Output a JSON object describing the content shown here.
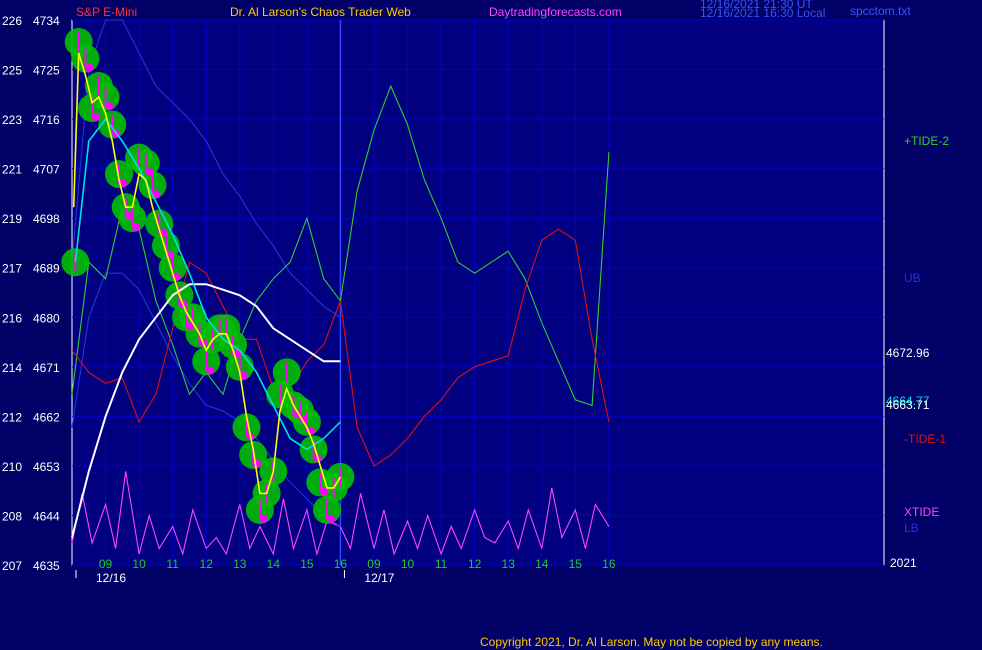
{
  "header": {
    "instrument": "S&P E-Mini",
    "title": "Dr. Al Larson's Chaos Trader Web",
    "site": "Daytradingforecasts.com",
    "stamp_line1": "12/16/2021 21:30 UT",
    "stamp_line2": "12/16/2021 16:30 Local",
    "file": "spcctom.txt"
  },
  "footer": {
    "copyright": "Copyright 2021, Dr. Al Larson. May not be copied by any means.",
    "year": "2021"
  },
  "colors": {
    "background": "#000066",
    "plot_bg": "#000080",
    "grid": "#0000cc",
    "price_bars": "#ff00ff",
    "halo": "#00c000",
    "fast_ma": "#ffff00",
    "mid_ma": "#00e0e0",
    "slow_ma": "#ffffff",
    "tide_plus": "#33cc33",
    "tide_minus": "#e01010",
    "xtide": "#ff44ff",
    "bands": "#2233dd",
    "axis_text": "#ffffff",
    "hour_labels": "#22cc22",
    "title_text": "#ffcc00",
    "site_text": "#ff44ff"
  },
  "chart_data": {
    "type": "line",
    "y_axis_pairs": [
      {
        "cycle": "226",
        "price": "4734"
      },
      {
        "cycle": "225",
        "price": "4725"
      },
      {
        "cycle": "223",
        "price": "4716"
      },
      {
        "cycle": "221",
        "price": "4707"
      },
      {
        "cycle": "219",
        "price": "4698"
      },
      {
        "cycle": "217",
        "price": "4689"
      },
      {
        "cycle": "216",
        "price": "4680"
      },
      {
        "cycle": "214",
        "price": "4671"
      },
      {
        "cycle": "212",
        "price": "4662"
      },
      {
        "cycle": "210",
        "price": "4653"
      },
      {
        "cycle": "208",
        "price": "4644"
      },
      {
        "cycle": "207",
        "price": "4635"
      }
    ],
    "ylim": [
      4635,
      4734
    ],
    "xlim": [
      8,
      32.2
    ],
    "hour_ticks": [
      {
        "x": 9,
        "label": "09"
      },
      {
        "x": 10,
        "label": "10"
      },
      {
        "x": 11,
        "label": "11"
      },
      {
        "x": 12,
        "label": "12"
      },
      {
        "x": 13,
        "label": "13"
      },
      {
        "x": 14,
        "label": "14"
      },
      {
        "x": 15,
        "label": "15"
      },
      {
        "x": 16,
        "label": "16"
      },
      {
        "x": 17,
        "label": "09"
      },
      {
        "x": 18,
        "label": "10"
      },
      {
        "x": 19,
        "label": "11"
      },
      {
        "x": 20,
        "label": "12"
      },
      {
        "x": 21,
        "label": "13"
      },
      {
        "x": 22,
        "label": "14"
      },
      {
        "x": 23,
        "label": "15"
      },
      {
        "x": 24,
        "label": "16"
      }
    ],
    "dates": [
      {
        "x": 8,
        "label": "12/16"
      },
      {
        "x": 16,
        "label": "12/17"
      }
    ],
    "day_divider_x": 16,
    "grid": true,
    "price_bars": {
      "name": "",
      "x": [
        8.1,
        8.2,
        8.4,
        8.6,
        8.8,
        9.0,
        9.2,
        9.4,
        9.6,
        9.8,
        10.0,
        10.2,
        10.4,
        10.6,
        10.8,
        11.0,
        11.2,
        11.4,
        11.6,
        11.8,
        12.0,
        12.2,
        12.4,
        12.6,
        12.8,
        13.0,
        13.2,
        13.4,
        13.6,
        13.8,
        14.0,
        14.2,
        14.4,
        14.6,
        14.8,
        15.0,
        15.2,
        15.4,
        15.6,
        15.8,
        16.0
      ],
      "y": [
        4690,
        4730,
        4727,
        4718,
        4722,
        4720,
        4715,
        4706,
        4700,
        4698,
        4709,
        4708,
        4704,
        4697,
        4693,
        4689,
        4684,
        4680,
        4680,
        4677,
        4672,
        4676,
        4678,
        4678,
        4675,
        4671,
        4660,
        4655,
        4645,
        4648,
        4652,
        4666,
        4670,
        4664,
        4663,
        4661,
        4656,
        4650,
        4645,
        4649,
        4651
      ]
    },
    "series": [
      {
        "name": "",
        "role": "fast-ma",
        "x": [
          8.05,
          8.2,
          8.4,
          8.6,
          8.8,
          9.0,
          9.2,
          9.4,
          9.6,
          9.8,
          10.0,
          10.2,
          10.4,
          10.6,
          10.8,
          11.0,
          11.2,
          11.4,
          11.6,
          11.8,
          12.0,
          12.2,
          12.4,
          12.6,
          12.8,
          13.0,
          13.2,
          13.4,
          13.6,
          13.8,
          14.0,
          14.2,
          14.4,
          14.6,
          14.8,
          15.0,
          15.2,
          15.4,
          15.6,
          15.8,
          16.0
        ],
        "y": [
          4700,
          4728,
          4724,
          4719,
          4720,
          4717,
          4712,
          4705,
          4700,
          4700,
          4706,
          4705,
          4700,
          4696,
          4692,
          4688,
          4684,
          4681,
          4679,
          4677,
          4674,
          4676,
          4677,
          4677,
          4674,
          4670,
          4662,
          4656,
          4648,
          4648,
          4652,
          4663,
          4667,
          4664,
          4662,
          4660,
          4657,
          4653,
          4649,
          4649,
          4651
        ]
      },
      {
        "name": "",
        "role": "mid-ma",
        "x": [
          8.1,
          8.5,
          9.0,
          9.5,
          10.0,
          10.5,
          11.0,
          11.5,
          12.0,
          12.5,
          13.0,
          13.5,
          14.0,
          14.5,
          15.0,
          15.5,
          16.0
        ],
        "y": [
          4690,
          4712,
          4716,
          4712,
          4707,
          4701,
          4695,
          4688,
          4680,
          4676,
          4674,
          4670,
          4664,
          4658,
          4656,
          4658,
          4661
        ]
      },
      {
        "name": "",
        "role": "slow-ma",
        "x": [
          8.0,
          8.5,
          9.0,
          9.5,
          10.0,
          10.5,
          11.0,
          11.5,
          12.0,
          12.5,
          13.0,
          13.5,
          14.0,
          14.5,
          15.0,
          15.5,
          16.0
        ],
        "y": [
          4640,
          4652,
          4662,
          4670,
          4676,
          4680,
          4684,
          4686,
          4686,
          4685,
          4684,
          4682,
          4678,
          4676,
          4674,
          4672,
          4672
        ]
      },
      {
        "name": "+TIDE-2",
        "role": "tide-plus",
        "x": [
          8.0,
          8.5,
          9.0,
          9.5,
          10.0,
          10.5,
          11.0,
          11.5,
          12.0,
          12.5,
          13.0,
          13.5,
          14.0,
          14.5,
          15.0,
          15.5,
          16.0,
          16.5,
          17.0,
          17.5,
          18.0,
          18.5,
          19.0,
          19.5,
          20.0,
          20.5,
          21.0,
          21.5,
          22.0,
          22.5,
          23.0,
          23.5,
          24.0
        ],
        "y": [
          4666,
          4690,
          4687,
          4700,
          4696,
          4683,
          4675,
          4666,
          4670,
          4666,
          4676,
          4683,
          4687,
          4690,
          4698,
          4687,
          4683,
          4703,
          4714,
          4722,
          4715,
          4705,
          4698,
          4690,
          4688,
          4690,
          4692,
          4687,
          4679,
          4672,
          4665,
          4664,
          4710
        ]
      },
      {
        "name": "-TIDE-1",
        "role": "tide-minus",
        "x": [
          8.0,
          8.5,
          9.0,
          9.5,
          10.0,
          10.5,
          11.0,
          11.5,
          12.0,
          12.5,
          13.0,
          13.5,
          14.0,
          14.5,
          15.0,
          15.5,
          16.0,
          16.5,
          17.0,
          17.5,
          18.0,
          18.5,
          19.0,
          19.5,
          20.0,
          20.5,
          21.0,
          21.5,
          22.0,
          22.5,
          23.0,
          23.5,
          24.0
        ],
        "y": [
          4674,
          4670,
          4668,
          4669,
          4661,
          4666,
          4678,
          4690,
          4688,
          4682,
          4676,
          4676,
          4667,
          4667,
          4672,
          4675,
          4683,
          4660,
          4653,
          4655,
          4658,
          4662,
          4665,
          4669,
          4671,
          4672,
          4673,
          4685,
          4694,
          4696,
          4694,
          4676,
          4661
        ]
      },
      {
        "name": "XTIDE",
        "role": "xtide",
        "x": [
          8.0,
          8.3,
          8.6,
          9.0,
          9.3,
          9.6,
          10.0,
          10.3,
          10.6,
          11.0,
          11.3,
          11.6,
          12.0,
          12.3,
          12.6,
          13.0,
          13.3,
          13.6,
          14.0,
          14.3,
          14.6,
          15.0,
          15.3,
          15.6,
          16.0,
          16.3,
          16.6,
          17.0,
          17.3,
          17.6,
          18.0,
          18.3,
          18.6,
          19.0,
          19.3,
          19.6,
          20.0,
          20.3,
          20.6,
          21.0,
          21.3,
          21.6,
          22.0,
          22.3,
          22.6,
          23.0,
          23.3,
          23.6,
          24.0
        ],
        "y": [
          4639,
          4648,
          4639,
          4646,
          4638,
          4652,
          4637,
          4644,
          4638,
          4642,
          4637,
          4645,
          4638,
          4640,
          4637,
          4646,
          4638,
          4642,
          4637,
          4647,
          4638,
          4645,
          4637,
          4643,
          4642,
          4638,
          4648,
          4638,
          4645,
          4637,
          4643,
          4638,
          4644,
          4637,
          4642,
          4638,
          4645,
          4640,
          4639,
          4643,
          4638,
          4645,
          4638,
          4649,
          4640,
          4645,
          4638,
          4646,
          4642
        ]
      },
      {
        "name": "UB",
        "role": "upper-band",
        "x": [
          8.0,
          8.5,
          9.0,
          9.5,
          10.0,
          10.5,
          11.0,
          11.5,
          12.0,
          12.5,
          13.0,
          13.5,
          14.0,
          14.5,
          15.0,
          15.5,
          16.0
        ],
        "y": [
          4690,
          4725,
          4734,
          4734,
          4728,
          4722,
          4719,
          4716,
          4712,
          4706,
          4702,
          4697,
          4693,
          4688,
          4685,
          4682,
          4680
        ]
      },
      {
        "name": "LB",
        "role": "lower-band",
        "x": [
          8.0,
          8.5,
          9.0,
          9.5,
          10.0,
          10.5,
          11.0,
          11.5,
          12.0,
          12.5,
          13.0,
          13.5,
          14.0,
          14.5,
          15.0,
          15.5,
          16.0
        ],
        "y": [
          4660,
          4680,
          4688,
          4688,
          4685,
          4679,
          4673,
          4668,
          4664,
          4663,
          4661,
          4658,
          4654,
          4650,
          4647,
          4644,
          4642
        ]
      }
    ],
    "right_labels": [
      {
        "name": "+TIDE-2",
        "series": "tide-plus"
      },
      {
        "name": "UB",
        "series": "upper-band"
      },
      {
        "name": "-TIDE-1",
        "series": "tide-minus"
      },
      {
        "name": "XTIDE",
        "series": "xtide"
      },
      {
        "name": "LB",
        "series": "lower-band"
      }
    ],
    "price_readouts": [
      {
        "value": "4672.96",
        "role": "slow-ma"
      },
      {
        "value": "4664.77",
        "role": "mid-ma"
      },
      {
        "value": "4663.71",
        "role": "fast-ma"
      }
    ]
  }
}
